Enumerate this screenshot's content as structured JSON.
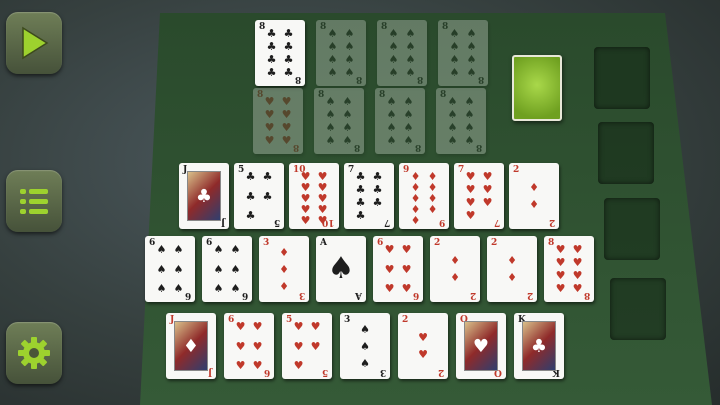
{
  "colors": {
    "felt": "#2d4a2f",
    "accent": "#8dbb2f",
    "card_back": "#8fc23a"
  },
  "sidebar": [
    {
      "name": "play-button",
      "icon": "play-icon"
    },
    {
      "name": "menu-button",
      "icon": "list-icon"
    },
    {
      "name": "settings-button",
      "icon": "gear-icon"
    }
  ],
  "top_row": [
    {
      "rank": "8",
      "suit": "♣",
      "color": "black",
      "ghost": false
    },
    {
      "rank": "8",
      "suit": "♠",
      "color": "black",
      "ghost": true
    },
    {
      "rank": "8",
      "suit": "♠",
      "color": "black",
      "ghost": true
    },
    {
      "rank": "8",
      "suit": "♠",
      "color": "black",
      "ghost": true
    }
  ],
  "second_row": [
    {
      "rank": "8",
      "suit": "♥",
      "color": "red",
      "ghost": true
    },
    {
      "rank": "8",
      "suit": "♠",
      "color": "black",
      "ghost": true
    },
    {
      "rank": "8",
      "suit": "♠",
      "color": "black",
      "ghost": true
    },
    {
      "rank": "8",
      "suit": "♠",
      "color": "black",
      "ghost": true
    }
  ],
  "row1": [
    {
      "rank": "J",
      "suit": "♣",
      "color": "black",
      "face": true
    },
    {
      "rank": "5",
      "suit": "♣",
      "color": "black"
    },
    {
      "rank": "10",
      "suit": "♥",
      "color": "red"
    },
    {
      "rank": "7",
      "suit": "♣",
      "color": "black"
    },
    {
      "rank": "9",
      "suit": "♦",
      "color": "red"
    },
    {
      "rank": "7",
      "suit": "♥",
      "color": "red"
    },
    {
      "rank": "2",
      "suit": "♦",
      "color": "red"
    }
  ],
  "row2": [
    {
      "rank": "6",
      "suit": "♠",
      "color": "black"
    },
    {
      "rank": "6",
      "suit": "♠",
      "color": "black"
    },
    {
      "rank": "3",
      "suit": "♦",
      "color": "red"
    },
    {
      "rank": "A",
      "suit": "♠",
      "color": "black",
      "ace": true
    },
    {
      "rank": "6",
      "suit": "♥",
      "color": "red"
    },
    {
      "rank": "2",
      "suit": "♦",
      "color": "red"
    },
    {
      "rank": "2",
      "suit": "♦",
      "color": "red"
    },
    {
      "rank": "8",
      "suit": "♥",
      "color": "red"
    }
  ],
  "row3": [
    {
      "rank": "J",
      "suit": "♦",
      "color": "red",
      "face": true
    },
    {
      "rank": "6",
      "suit": "♥",
      "color": "red"
    },
    {
      "rank": "5",
      "suit": "♥",
      "color": "red"
    },
    {
      "rank": "3",
      "suit": "♠",
      "color": "black"
    },
    {
      "rank": "2",
      "suit": "♥",
      "color": "red"
    },
    {
      "rank": "Q",
      "suit": "♥",
      "color": "red",
      "face": true
    },
    {
      "rank": "K",
      "suit": "♣",
      "color": "black",
      "face": true
    }
  ]
}
